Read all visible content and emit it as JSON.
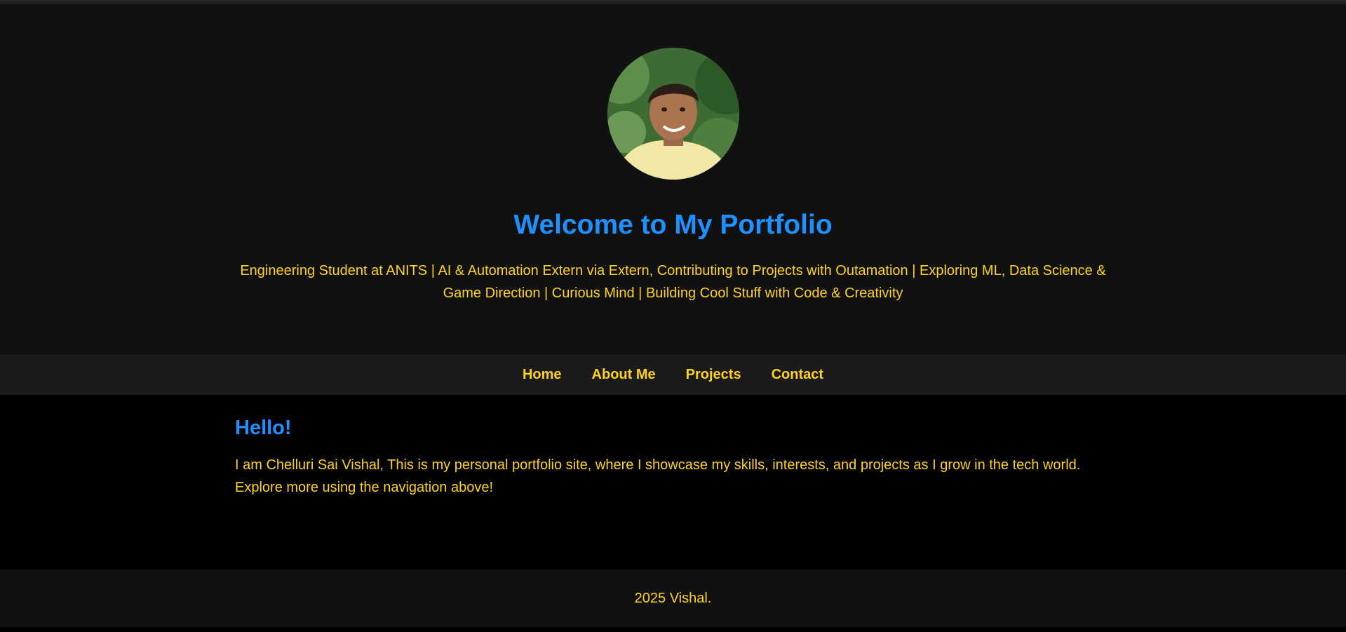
{
  "colors": {
    "accent": "#1e90ff",
    "text": "#ffd21a",
    "header_bg": "#111111",
    "nav_bg": "#1b1b1b",
    "body_bg": "#000000"
  },
  "header": {
    "avatar_icon": "profile-photo",
    "title": "Welcome to My Portfolio",
    "subtitle": "Engineering Student at ANITS | AI & Automation Extern via Extern, Contributing to Projects with Outamation | Exploring ML, Data Science & Game Direction | Curious Mind | Building Cool Stuff with Code & Creativity"
  },
  "nav": {
    "items": [
      {
        "label": "Home"
      },
      {
        "label": "About Me"
      },
      {
        "label": "Projects"
      },
      {
        "label": "Contact"
      }
    ]
  },
  "main": {
    "heading": "Hello!",
    "intro": "I am Chelluri Sai Vishal, This is my personal portfolio site, where I showcase my skills, interests, and projects as I grow in the tech world. Explore more using the navigation above!"
  },
  "footer": {
    "text": "2025 Vishal."
  }
}
